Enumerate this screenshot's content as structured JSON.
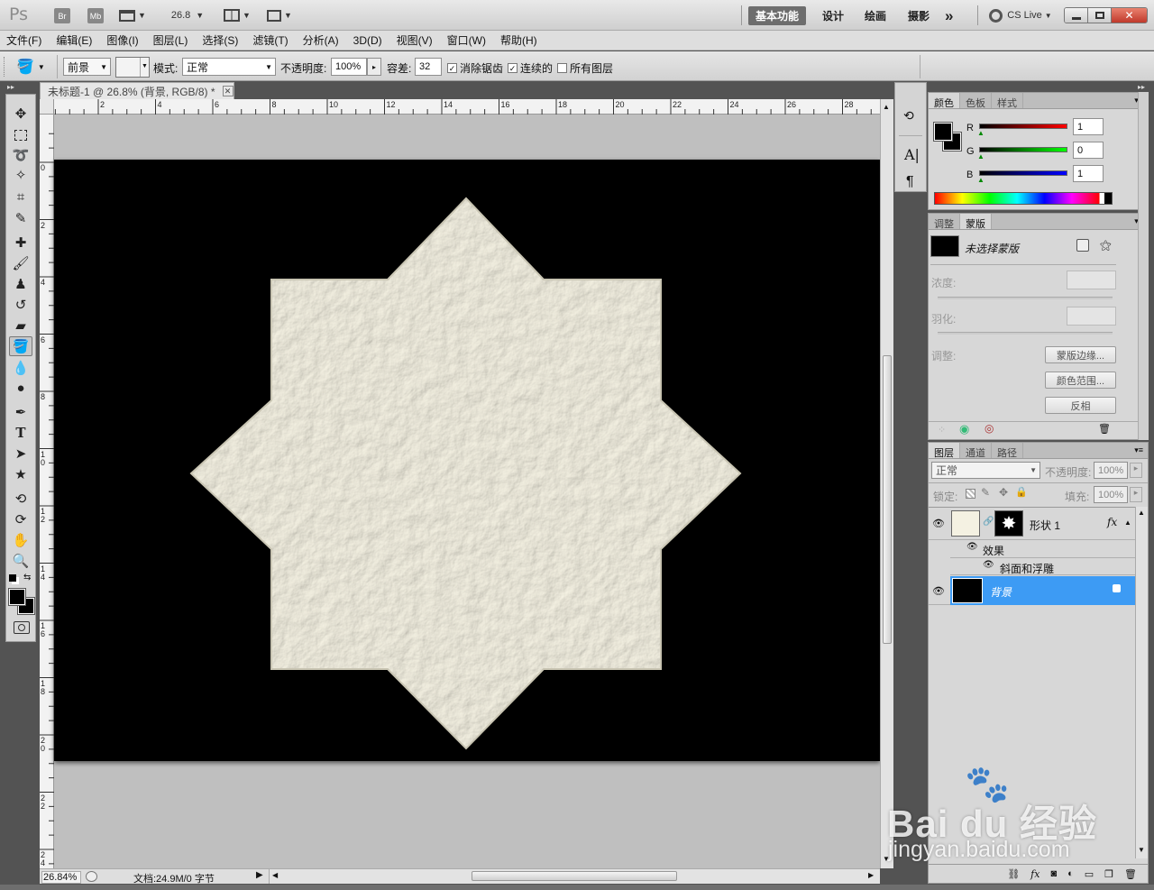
{
  "app": {
    "logo": "Ps",
    "bridge": "Br",
    "minibridge": "Mb",
    "zoom": "26.8",
    "workspaces": [
      "基本功能",
      "设计",
      "绘画",
      "摄影"
    ],
    "more": "»",
    "cslive": "CS Live"
  },
  "menu": [
    "文件(F)",
    "编辑(E)",
    "图像(I)",
    "图层(L)",
    "选择(S)",
    "滤镜(T)",
    "分析(A)",
    "3D(D)",
    "视图(V)",
    "窗口(W)",
    "帮助(H)"
  ],
  "options": {
    "fill_source": "前景",
    "mode_label": "模式:",
    "mode_value": "正常",
    "opacity_label": "不透明度:",
    "opacity_value": "100%",
    "tolerance_label": "容差:",
    "tolerance_value": "32",
    "antialias_label": "消除锯齿",
    "contiguous_label": "连续的",
    "all_layers_label": "所有图层",
    "antialias_checked": true,
    "contiguous_checked": true,
    "all_layers_checked": false
  },
  "document": {
    "tab_title": "未标题-1 @ 26.8% (背景, RGB/8) *",
    "ruler_h": [
      "2",
      "4",
      "6",
      "8",
      "10",
      "12",
      "14",
      "16",
      "18",
      "20",
      "22",
      "24",
      "26",
      "28"
    ],
    "ruler_v": [
      "0",
      "2",
      "4",
      "6",
      "8",
      "10",
      "12",
      "14",
      "16",
      "18",
      "20",
      "22",
      "24"
    ],
    "canvas_color": "#000000",
    "shape_color": "#f4f1e2"
  },
  "status": {
    "zoom": "26.84%",
    "doc_info": "文档:24.9M/0 字节"
  },
  "color_panel": {
    "tabs": [
      "颜色",
      "色板",
      "样式"
    ],
    "channels": [
      {
        "label": "R",
        "value": "1"
      },
      {
        "label": "G",
        "value": "0"
      },
      {
        "label": "B",
        "value": "1"
      }
    ]
  },
  "mask_panel": {
    "tabs": [
      "调整",
      "蒙版"
    ],
    "title": "未选择蒙版",
    "density_label": "浓度:",
    "feather_label": "羽化:",
    "refine_label": "调整:",
    "btn_edge": "蒙版边缘...",
    "btn_range": "颜色范围...",
    "btn_invert": "反相"
  },
  "layers_panel": {
    "tabs": [
      "图层",
      "通道",
      "路径"
    ],
    "blend_mode": "正常",
    "opacity_label": "不透明度:",
    "opacity_value": "100%",
    "lock_label": "锁定:",
    "fill_label": "填充:",
    "fill_value": "100%",
    "layers": [
      {
        "name": "形状 1",
        "fx": "fx",
        "effects_label": "效果",
        "effect": "斜面和浮雕"
      },
      {
        "name": "背景",
        "selected": true
      }
    ]
  },
  "colors": {
    "accent": "#3d9bf4",
    "foreground": "#000000",
    "background": "#ffffff"
  },
  "watermark": {
    "brand": "Bai du 经验",
    "url": "jingyan.baidu.com"
  }
}
